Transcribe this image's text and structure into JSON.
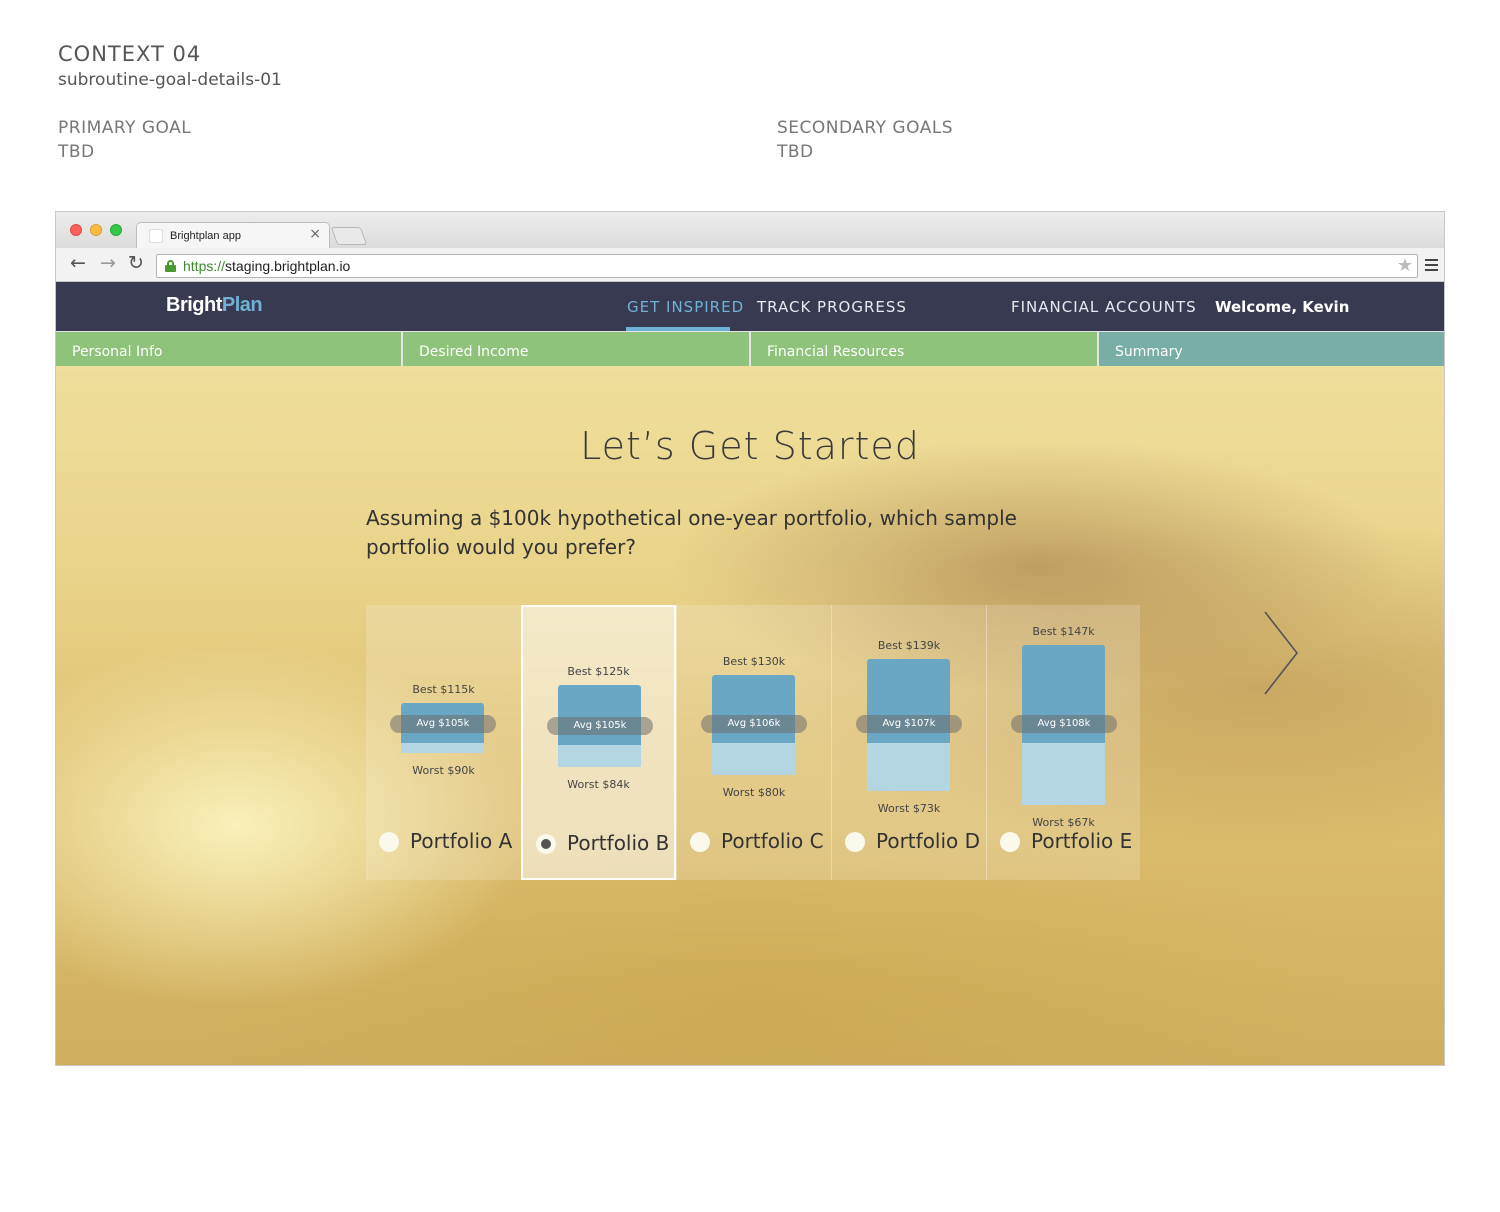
{
  "spec": {
    "context": "CONTEXT 04",
    "screen_id": "subroutine-goal-details-01",
    "primary_goal_label": "PRIMARY GOAL",
    "primary_goal_value": "TBD",
    "secondary_goals_label": "SECONDARY GOALS",
    "secondary_goals_value": "TBD"
  },
  "browser": {
    "tab_title": "Brightplan app",
    "tab_close": "×",
    "url_scheme": "https://",
    "url_host": "staging.brightplan.io"
  },
  "nav": {
    "logo_part1": "Bright",
    "logo_part2": "Plan",
    "links": [
      "GET INSPIRED",
      "TRACK PROGRESS",
      "FINANCIAL ACCOUNTS"
    ],
    "active_link": "GET INSPIRED",
    "welcome": "Welcome, Kevin",
    "colors": {
      "navbar": "#383a52",
      "accent": "#6fb2d6"
    }
  },
  "steps": [
    {
      "label": "Personal Info",
      "color": "#8fc27a"
    },
    {
      "label": "Desired Income",
      "color": "#8fc27a"
    },
    {
      "label": "Financial Resources",
      "color": "#8fc27a"
    },
    {
      "label": "Summary",
      "color": "#78aea6"
    }
  ],
  "main": {
    "title": "Let’s Get Started",
    "question": "Assuming a $100k hypothetical one-year portfolio, which sample portfolio would you prefer?"
  },
  "portfolios": [
    {
      "name": "Portfolio A",
      "best_label": "Best $115k",
      "avg_label": "Avg $105k",
      "worst_label": "Worst $90k",
      "best": 115,
      "avg": 105,
      "worst": 90,
      "selected": false
    },
    {
      "name": "Portfolio B",
      "best_label": "Best $125k",
      "avg_label": "Avg $105k",
      "worst_label": "Worst $84k",
      "best": 125,
      "avg": 105,
      "worst": 84,
      "selected": true
    },
    {
      "name": "Portfolio C",
      "best_label": "Best $130k",
      "avg_label": "Avg $106k",
      "worst_label": "Worst $80k",
      "best": 130,
      "avg": 106,
      "worst": 80,
      "selected": false
    },
    {
      "name": "Portfolio D",
      "best_label": "Best $139k",
      "avg_label": "Avg $107k",
      "worst_label": "Worst $73k",
      "best": 139,
      "avg": 107,
      "worst": 73,
      "selected": false
    },
    {
      "name": "Portfolio E",
      "best_label": "Best $147k",
      "avg_label": "Avg $108k",
      "worst_label": "Worst $67k",
      "best": 147,
      "avg": 108,
      "worst": 67,
      "selected": false
    }
  ],
  "icons": {
    "next": "chevron-right-icon",
    "back": "arrow-left-icon",
    "forward": "arrow-right-icon",
    "reload": "reload-icon",
    "lock": "lock-icon",
    "bookmark": "star-icon",
    "menu": "hamburger-menu-icon"
  }
}
